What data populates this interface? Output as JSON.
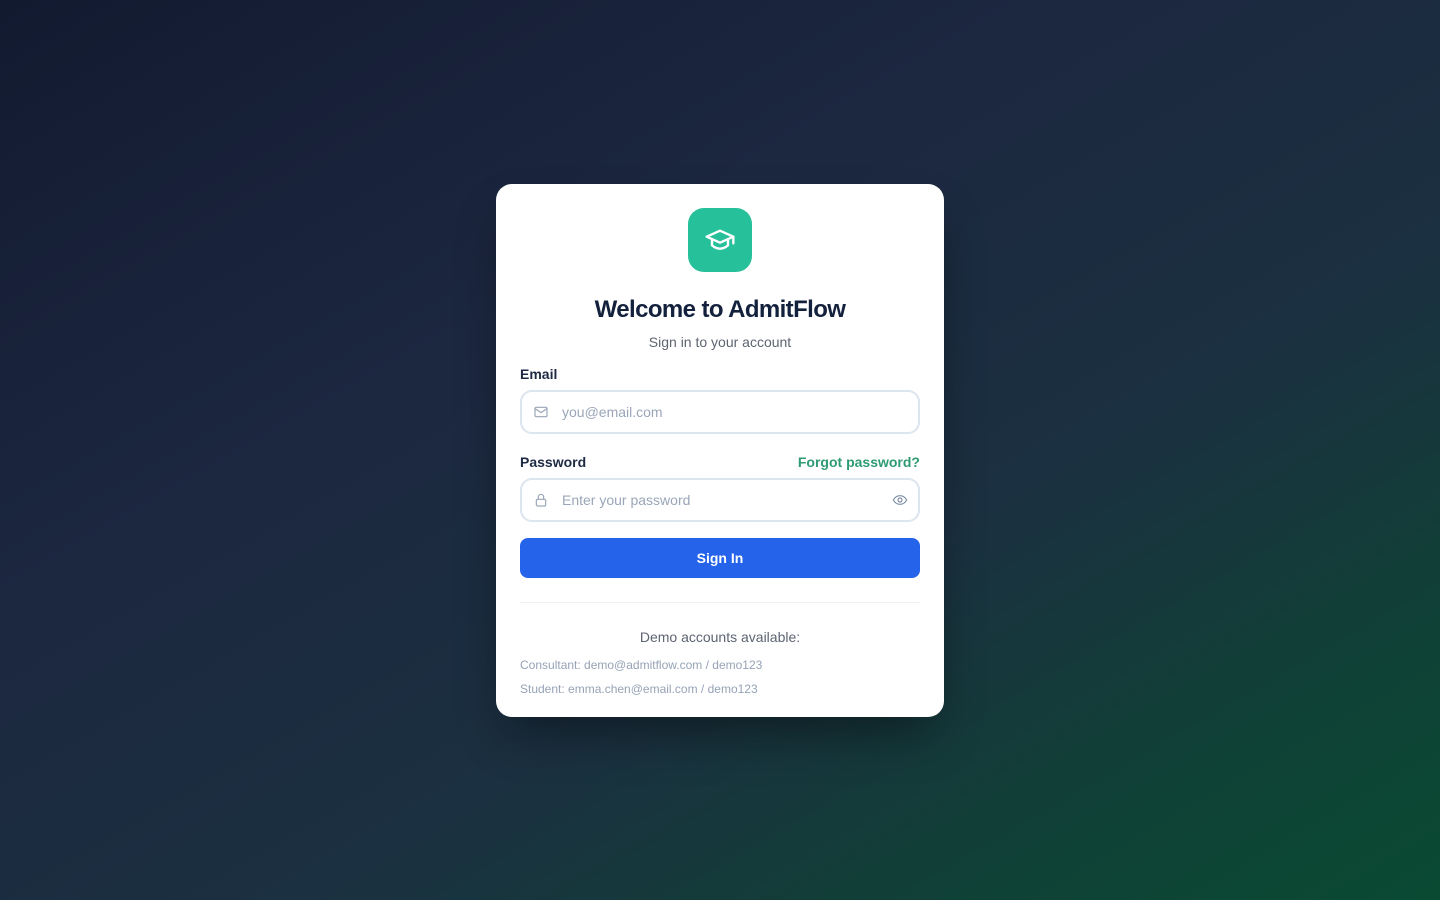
{
  "brand": {
    "logo_icon": "graduation-cap-icon",
    "accent_color": "#26c09a"
  },
  "header": {
    "title": "Welcome to AdmitFlow",
    "subtitle": "Sign in to your account"
  },
  "form": {
    "email": {
      "label": "Email",
      "placeholder": "you@email.com",
      "value": "",
      "icon": "mail-icon"
    },
    "password": {
      "label": "Password",
      "placeholder": "Enter your password",
      "value": "",
      "icon": "lock-icon",
      "toggle_icon": "eye-icon",
      "forgot_label": "Forgot password?"
    },
    "submit_label": "Sign In",
    "submit_color": "#2563eb"
  },
  "demo": {
    "title": "Demo accounts available:",
    "accounts": [
      "Consultant: demo@admitflow.com / demo123",
      "Student: emma.chen@email.com / demo123"
    ]
  }
}
